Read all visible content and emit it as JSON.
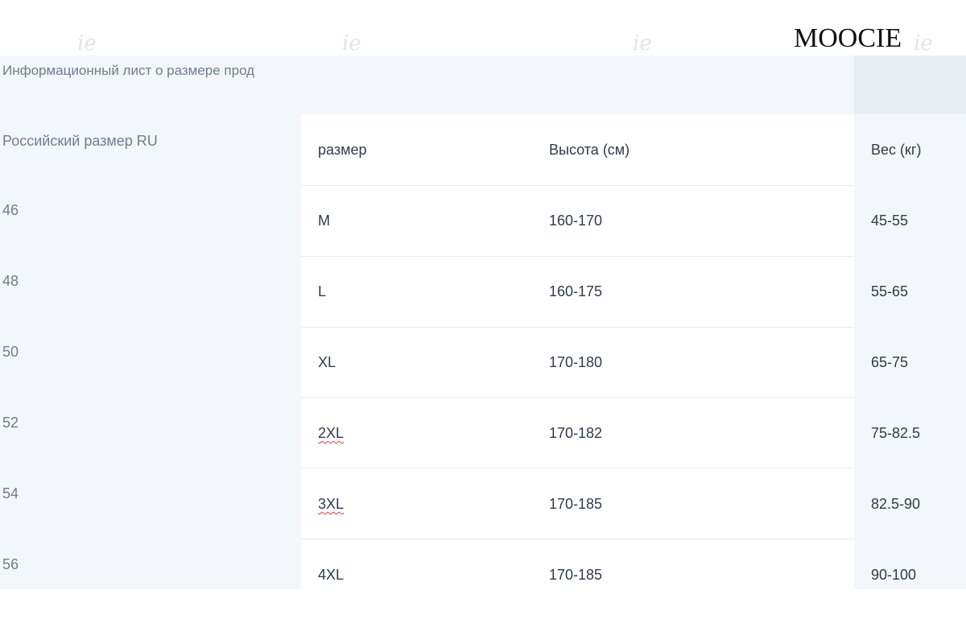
{
  "brand": "MOOCIE",
  "table": {
    "title": "Информационный лист о размере прод",
    "headers": {
      "ru": "Российский размер RU",
      "size": "размер",
      "height": "Высота (см)",
      "weight": "Вес (кг)"
    },
    "rows": [
      {
        "ru": "46",
        "size": "M",
        "height": "160-170",
        "weight": "45-55"
      },
      {
        "ru": "48",
        "size": "L",
        "height": "160-175",
        "weight": "55-65"
      },
      {
        "ru": "50",
        "size": "XL",
        "height": "170-180",
        "weight": "65-75"
      },
      {
        "ru": "52",
        "size": "2XL",
        "height": "170-182",
        "weight": "75-82.5"
      },
      {
        "ru": "54",
        "size": "3XL",
        "height": "170-185",
        "weight": "82.5-90"
      },
      {
        "ru": "56",
        "size": "4XL",
        "height": "170-185",
        "weight": "90-100"
      }
    ]
  },
  "colors": {
    "first_column_bg": "#f3f6fa",
    "header_corner_bg": "#e8edf4",
    "text_dark": "#2f3b4c",
    "text_muted": "#6f7d8f",
    "spellcheck_underline": "#e03a3a"
  }
}
